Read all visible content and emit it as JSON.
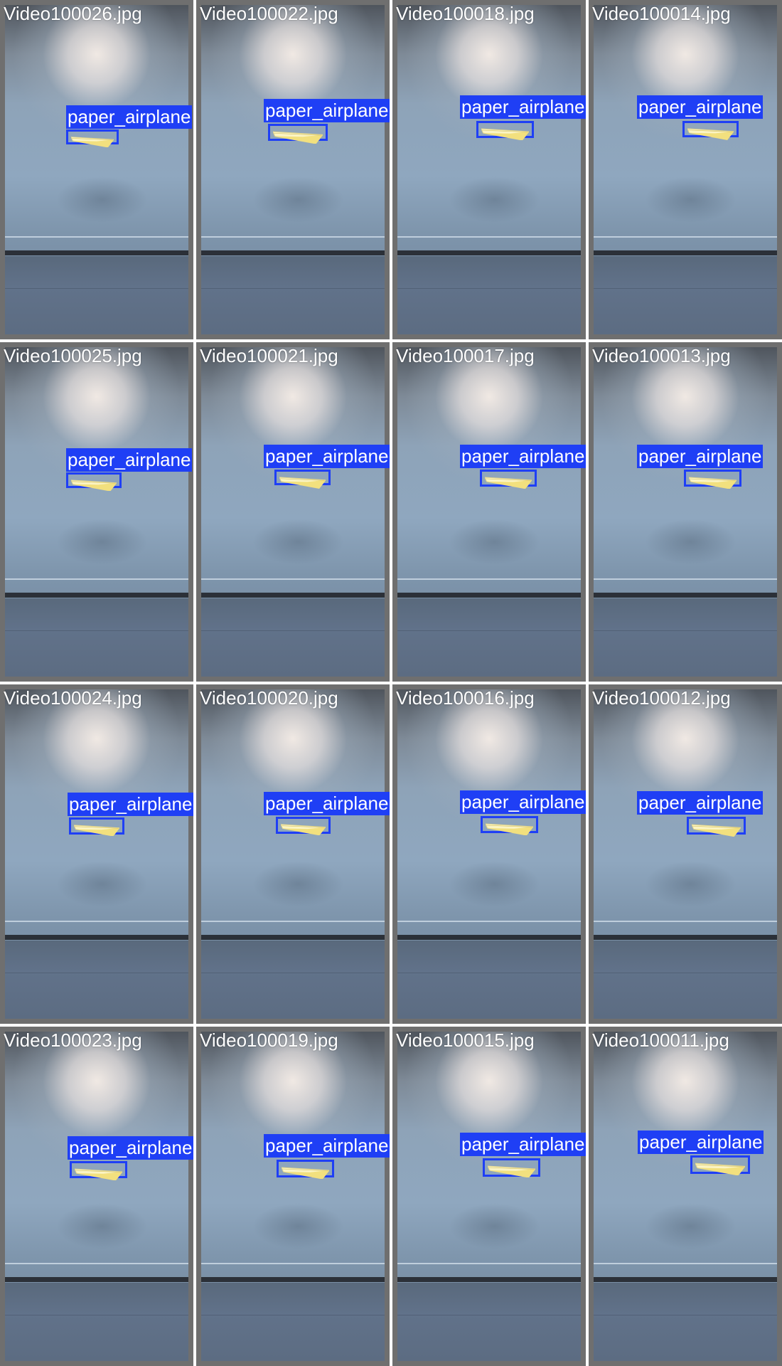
{
  "colors": {
    "box": "#1f3ff5",
    "label_text": "#ffffff",
    "tile_border": "#6f6f6f",
    "page_background": "#ffffff"
  },
  "grid": {
    "columns": 4,
    "rows": 4
  },
  "tiles": [
    {
      "filename": "Video100026.jpg",
      "detection": {
        "label": "paper_airplane"
      }
    },
    {
      "filename": "Video100022.jpg",
      "detection": {
        "label": "paper_airplane"
      }
    },
    {
      "filename": "Video100018.jpg",
      "detection": {
        "label": "paper_airplane"
      }
    },
    {
      "filename": "Video100014.jpg",
      "detection": {
        "label": "paper_airplane"
      }
    },
    {
      "filename": "Video100025.jpg",
      "detection": {
        "label": "paper_airplane"
      }
    },
    {
      "filename": "Video100021.jpg",
      "detection": {
        "label": "paper_airplane"
      }
    },
    {
      "filename": "Video100017.jpg",
      "detection": {
        "label": "paper_airplane"
      }
    },
    {
      "filename": "Video100013.jpg",
      "detection": {
        "label": "paper_airplane"
      }
    },
    {
      "filename": "Video100024.jpg",
      "detection": {
        "label": "paper_airplane"
      }
    },
    {
      "filename": "Video100020.jpg",
      "detection": {
        "label": "paper_airplane"
      }
    },
    {
      "filename": "Video100016.jpg",
      "detection": {
        "label": "paper_airplane"
      }
    },
    {
      "filename": "Video100012.jpg",
      "detection": {
        "label": "paper_airplane"
      }
    },
    {
      "filename": "Video100023.jpg",
      "detection": {
        "label": "paper_airplane"
      }
    },
    {
      "filename": "Video100019.jpg",
      "detection": {
        "label": "paper_airplane"
      }
    },
    {
      "filename": "Video100015.jpg",
      "detection": {
        "label": "paper_airplane"
      }
    },
    {
      "filename": "Video100011.jpg",
      "detection": {
        "label": "paper_airplane"
      }
    }
  ]
}
